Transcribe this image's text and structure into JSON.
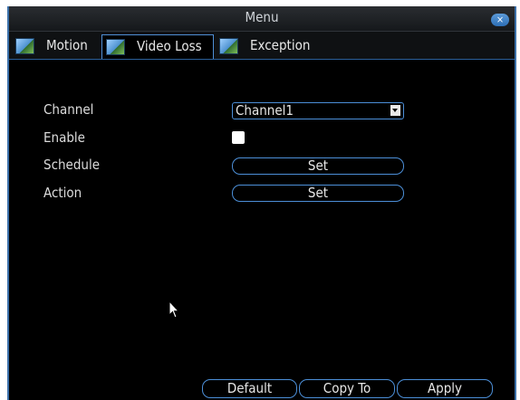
{
  "window": {
    "title": "Menu",
    "close_label": "×"
  },
  "tabs": [
    {
      "label": "Motion",
      "active": false
    },
    {
      "label": "Video Loss",
      "active": true
    },
    {
      "label": "Exception",
      "active": false
    }
  ],
  "form": {
    "channel_label": "Channel",
    "channel_value": "Channel1",
    "enable_label": "Enable",
    "enable_checked": false,
    "schedule_label": "Schedule",
    "schedule_button": "Set",
    "action_label": "Action",
    "action_button": "Set"
  },
  "footer": {
    "default_label": "Default",
    "copy_label": "Copy To",
    "apply_label": "Apply"
  },
  "colors": {
    "accent": "#4c8fd8",
    "background": "#000000"
  },
  "icons": {
    "tab_icon": "picture-icon",
    "close_icon": "close-icon",
    "dropdown_icon": "chevron-down-icon"
  }
}
